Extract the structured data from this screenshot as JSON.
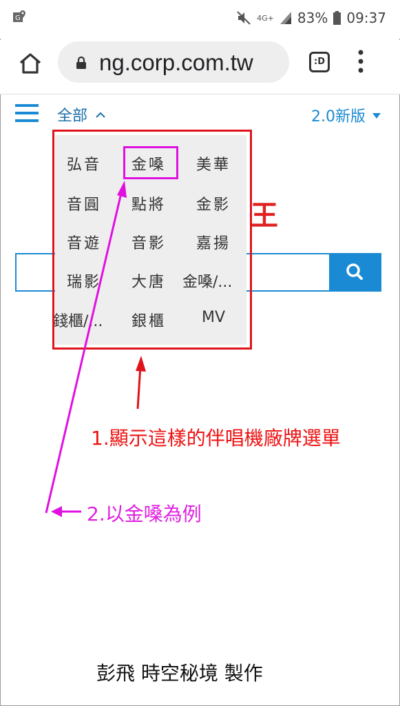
{
  "statusbar": {
    "network": "4G+",
    "battery": "83%",
    "time": "09:37"
  },
  "browser": {
    "url": "ng.corp.com.tw",
    "tab_switcher": ":D"
  },
  "page": {
    "category_selected": "全部",
    "version_label": "2.0新版",
    "partial_char": "王"
  },
  "dropdown": {
    "items": [
      "弘音",
      "金嗓",
      "美華",
      "音圓",
      "點將",
      "金影",
      "音遊",
      "音影",
      "嘉揚",
      "瑞影",
      "大唐",
      "金嗓/...",
      "錢櫃/...",
      "銀櫃",
      "MV"
    ]
  },
  "annotations": {
    "note1": "1.顯示這樣的伴唱機廠牌選單",
    "note2": "2.以金嗓為例",
    "credit": "彭飛 時空秘境 製作"
  },
  "colors": {
    "accent": "#1a8ad4",
    "annotation_red": "#e0121a",
    "annotation_magenta": "#e010e0"
  }
}
